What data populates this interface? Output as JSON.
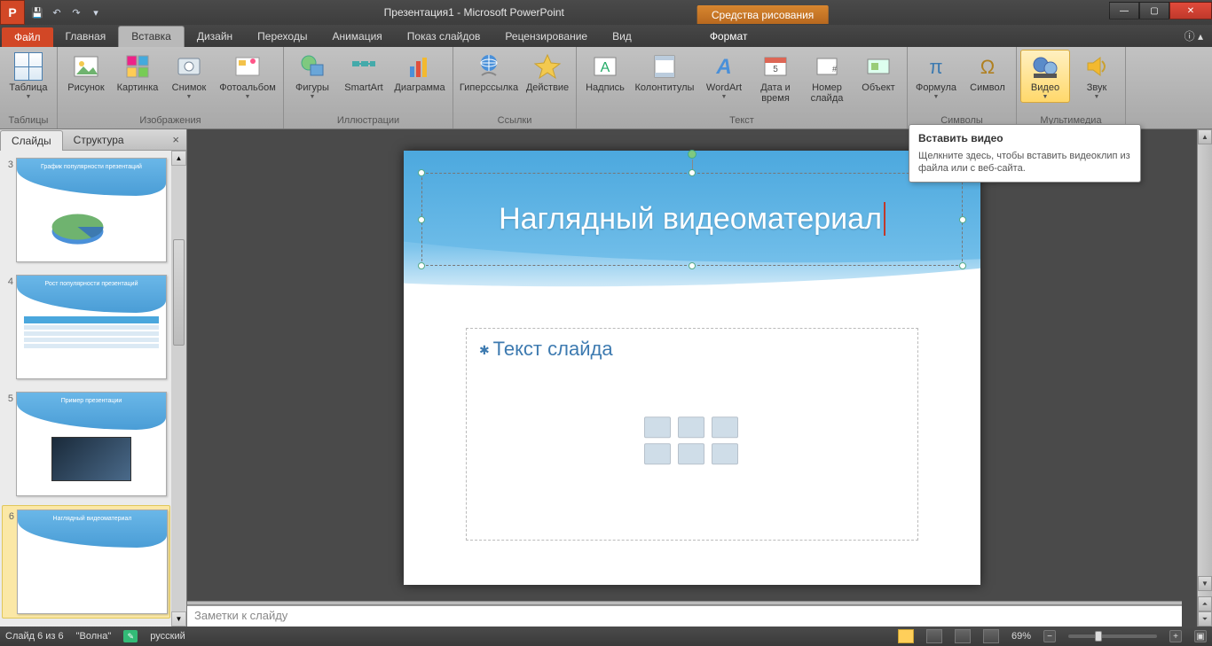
{
  "window": {
    "doc_title": "Презентация1 - Microsoft PowerPoint",
    "contextual_tab_group": "Средства рисования"
  },
  "tabs": {
    "file": "Файл",
    "home": "Главная",
    "insert": "Вставка",
    "design": "Дизайн",
    "transitions": "Переходы",
    "animation": "Анимация",
    "slideshow": "Показ слайдов",
    "review": "Рецензирование",
    "view": "Вид",
    "format": "Формат"
  },
  "ribbon": {
    "groups": {
      "tables": {
        "label": "Таблицы",
        "table": "Таблица"
      },
      "images": {
        "label": "Изображения",
        "picture": "Рисунок",
        "clipart": "Картинка",
        "screenshot": "Снимок",
        "photoalbum": "Фотоальбом"
      },
      "illustrations": {
        "label": "Иллюстрации",
        "shapes": "Фигуры",
        "smartart": "SmartArt",
        "chart": "Диаграмма"
      },
      "links": {
        "label": "Ссылки",
        "hyperlink": "Гиперссылка",
        "action": "Действие"
      },
      "text": {
        "label": "Текст",
        "textbox": "Надпись",
        "headerfooter": "Колонтитулы",
        "wordart": "WordArt",
        "datetime": "Дата и время",
        "slidenum": "Номер слайда",
        "object": "Объект"
      },
      "symbols": {
        "label": "Символы",
        "equation": "Формула",
        "symbol": "Символ"
      },
      "media": {
        "label": "Мультимедиа",
        "video": "Видео",
        "audio": "Звук"
      }
    }
  },
  "tooltip": {
    "title": "Вставить видео",
    "body": "Щелкните здесь, чтобы вставить видеоклип из файла или с веб-сайта."
  },
  "slidepanel": {
    "tab_slides": "Слайды",
    "tab_outline": "Структура",
    "thumbs": [
      {
        "num": "3",
        "title": "График популярности презентаций"
      },
      {
        "num": "4",
        "title": "Рост популярности презентаций"
      },
      {
        "num": "5",
        "title": "Пример презентации"
      },
      {
        "num": "6",
        "title": "Наглядный видеоматериал"
      }
    ]
  },
  "slide": {
    "title": "Наглядный видеоматериал",
    "content_placeholder": "Текст слайда"
  },
  "notes_placeholder": "Заметки к слайду",
  "status": {
    "slide_of": "Слайд 6 из 6",
    "theme": "\"Волна\"",
    "language": "русский",
    "zoom": "69%"
  }
}
